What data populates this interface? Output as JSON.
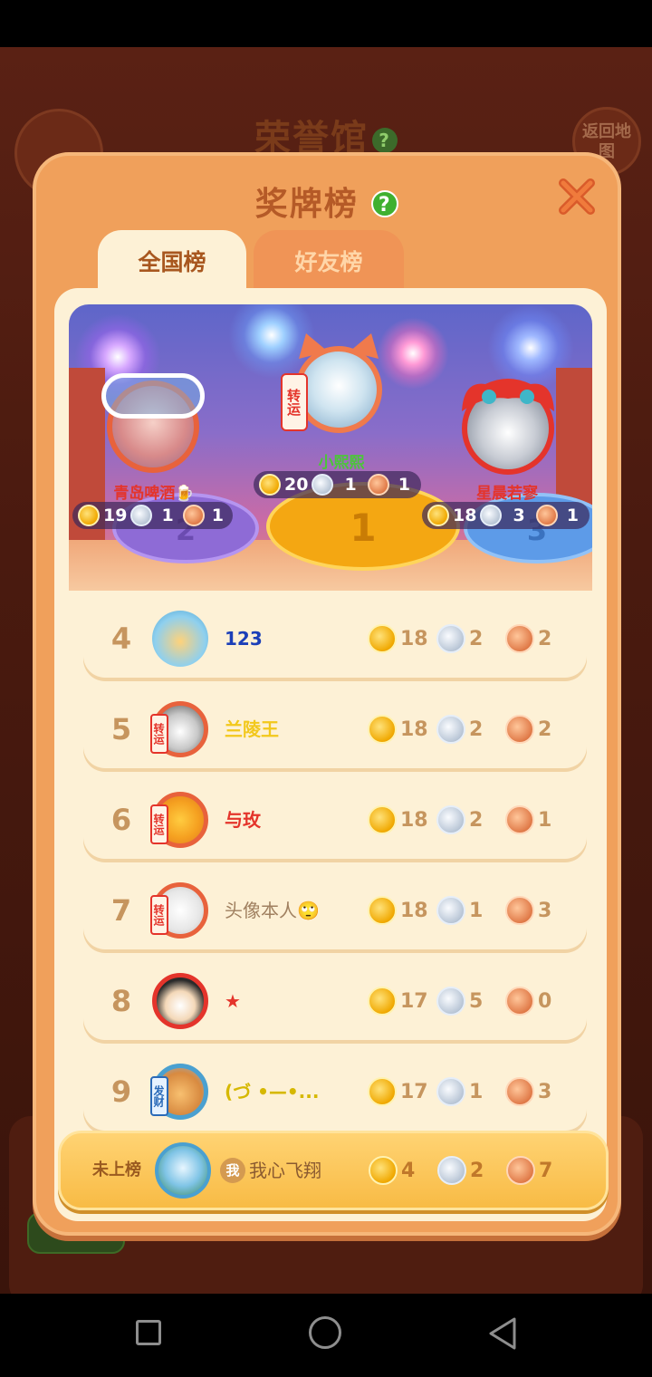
{
  "background": {
    "title": "荣誉馆",
    "help": "?",
    "back_button": "返回地图"
  },
  "modal": {
    "title": "奖牌榜",
    "help": "?",
    "tabs": [
      {
        "label": "全国榜",
        "active": true
      },
      {
        "label": "好友榜",
        "active": false
      }
    ]
  },
  "podium": [
    {
      "rank": "2",
      "name": "青岛啤酒🍺",
      "name_color": "#e4342b",
      "gold": "19",
      "silver": "1",
      "bronze": "1"
    },
    {
      "rank": "1",
      "name": "小熙熙",
      "name_color": "#4cc53a",
      "gold": "20",
      "silver": "1",
      "bronze": "1",
      "badge": "转运"
    },
    {
      "rank": "3",
      "name": "星晨若寥",
      "name_color": "#e4342b",
      "gold": "18",
      "silver": "3",
      "bronze": "1"
    }
  ],
  "rows": [
    {
      "rank": "4",
      "name": "123",
      "name_color": "#1b3fb8",
      "gold": "18",
      "silver": "2",
      "bronze": "2"
    },
    {
      "rank": "5",
      "name": "兰陵王",
      "name_color": "#f2c81c",
      "gold": "18",
      "silver": "2",
      "bronze": "2",
      "badge": "转运"
    },
    {
      "rank": "6",
      "name": "与玫",
      "name_color": "#e4342b",
      "gold": "18",
      "silver": "2",
      "bronze": "1",
      "badge": "转运"
    },
    {
      "rank": "7",
      "name": "头像本人🙄",
      "name_color": "#a08060",
      "gold": "18",
      "silver": "1",
      "bronze": "3",
      "badge": "转运"
    },
    {
      "rank": "8",
      "name": "★",
      "name_color": "#e4342b",
      "gold": "17",
      "silver": "5",
      "bronze": "0"
    },
    {
      "rank": "9",
      "name": "(づ •—•...",
      "name_color": "#d6b800",
      "gold": "17",
      "silver": "1",
      "bronze": "3",
      "badge": "发财"
    }
  ],
  "self": {
    "rank_label": "未上榜",
    "me_badge": "我",
    "name": "我心飞翔",
    "gold": "4",
    "silver": "2",
    "bronze": "7"
  }
}
